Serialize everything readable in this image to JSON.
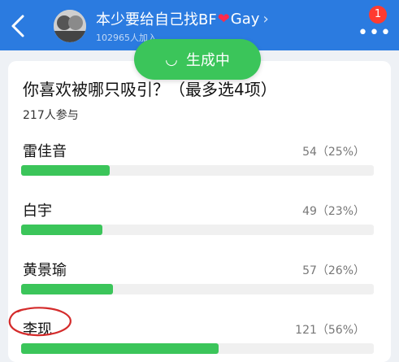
{
  "header": {
    "title_prefix": "本少要给自己找BF",
    "title_suffix": "Gay",
    "members": "102965人加入",
    "badge": "1",
    "heart_icon": "red-heart-icon",
    "back_icon": "chevron-left-icon",
    "more_icon": "ellipsis-icon"
  },
  "status_pill": {
    "label": "生成中",
    "icon": "smile-icon"
  },
  "poll": {
    "question": "你喜欢被哪只吸引？（最多选4项）",
    "participants": "217人参与",
    "options": [
      {
        "name": "雷佳音",
        "count": "54（25%）",
        "percent": 25
      },
      {
        "name": "白宇",
        "count": "49（23%）",
        "percent": 23
      },
      {
        "name": "黄景瑜",
        "count": "57（26%）",
        "percent": 26
      },
      {
        "name": "李现",
        "count": "121（56%）",
        "percent": 56
      }
    ]
  },
  "colors": {
    "header": "#2b7be0",
    "accent": "#3bc55a",
    "annotation": "#d42b2b"
  }
}
